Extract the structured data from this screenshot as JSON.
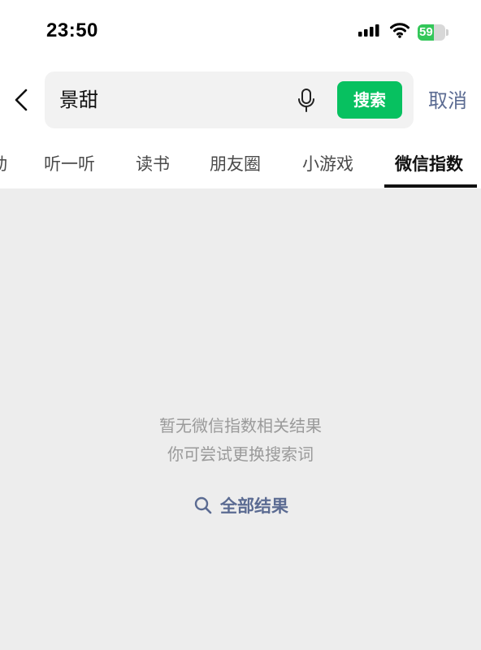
{
  "status_bar": {
    "time": "23:50",
    "battery": "59",
    "battery_level": 0.59,
    "accent": "#33c759"
  },
  "search": {
    "query": "景甜",
    "search_label": "搜索",
    "cancel_label": "取消",
    "button_color": "#07c160"
  },
  "tabs": [
    {
      "label": "动"
    },
    {
      "label": "听一听"
    },
    {
      "label": "读书"
    },
    {
      "label": "朋友圈"
    },
    {
      "label": "小游戏"
    },
    {
      "label": "微信指数",
      "active": true
    }
  ],
  "empty_state": {
    "line1": "暂无微信指数相关结果",
    "line2": "你可尝试更换搜索词",
    "all_results": "全部结果",
    "link_color": "#5b6b92"
  },
  "icons": [
    "signal-icon",
    "wifi-icon",
    "battery-icon",
    "back-icon",
    "mic-icon",
    "search-icon"
  ]
}
